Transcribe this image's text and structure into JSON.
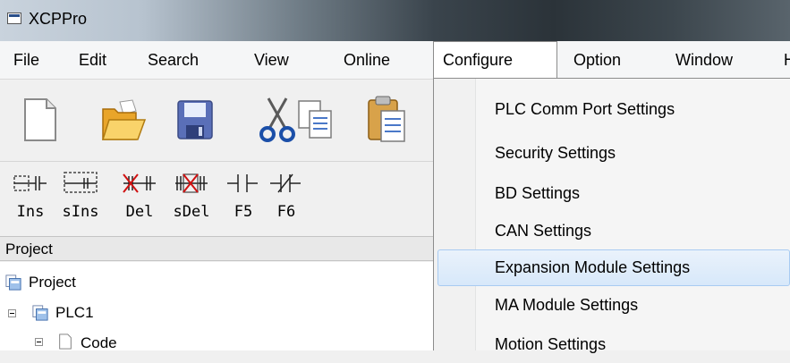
{
  "window": {
    "title": "XCPPro"
  },
  "menubar": {
    "items": [
      "File",
      "Edit",
      "Search",
      "View",
      "Online",
      "Configure",
      "Option",
      "Window",
      "H"
    ],
    "active": "Configure"
  },
  "toolbar1": {
    "icons": [
      "new-file-icon",
      "open-folder-icon",
      "save-icon",
      "cut-icon",
      "copy-icon",
      "paste-icon"
    ]
  },
  "toolbar2": {
    "buttons": [
      {
        "label": "Ins",
        "icon": "insert-contact-icon"
      },
      {
        "label": "sIns",
        "icon": "insert-row-icon"
      },
      {
        "label": "Del",
        "icon": "delete-contact-icon"
      },
      {
        "label": "sDel",
        "icon": "delete-row-icon"
      },
      {
        "label": "F5",
        "icon": "normally-open-contact-icon"
      },
      {
        "label": "F6",
        "icon": "normally-closed-contact-icon"
      }
    ]
  },
  "project": {
    "header": "Project",
    "tree": [
      {
        "label": "Project",
        "icon": "project-icon"
      },
      {
        "label": "PLC1",
        "icon": "plc-icon"
      },
      {
        "label": "Code",
        "icon": "document-icon"
      }
    ]
  },
  "configure_menu": {
    "items": [
      "PLC Comm Port Settings",
      "Security Settings",
      "BD Settings",
      "CAN Settings",
      "Expansion Module Settings",
      "MA Module Settings",
      "Motion Settings"
    ],
    "highlighted": "Expansion Module Settings"
  }
}
